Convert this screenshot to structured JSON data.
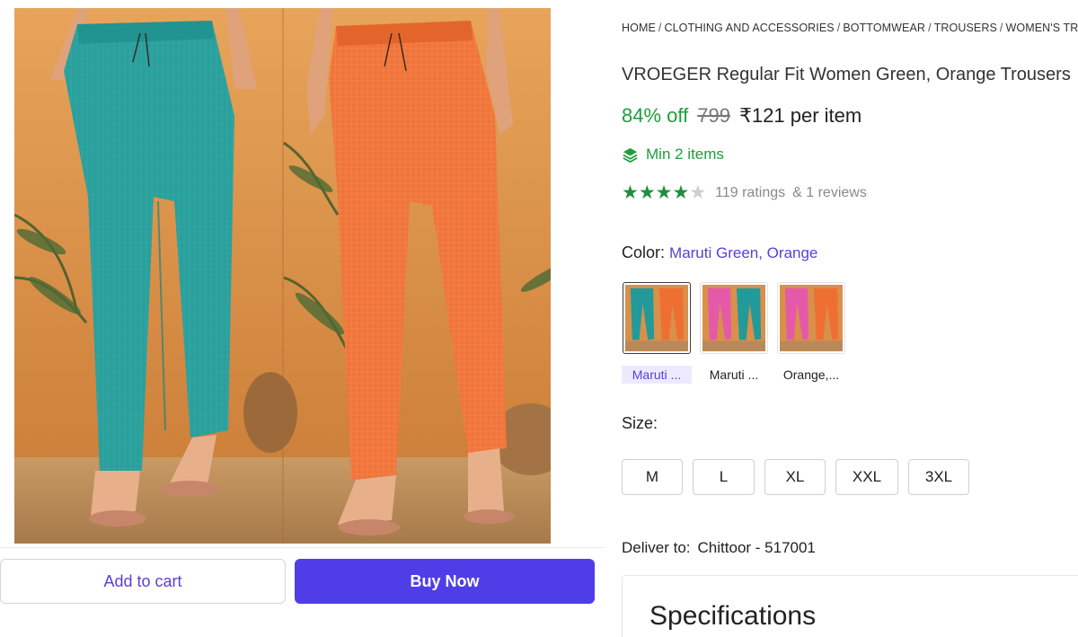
{
  "breadcrumb": [
    "HOME",
    "CLOTHING AND ACCESSORIES",
    "BOTTOMWEAR",
    "TROUSERS",
    "WOMEN'S TROUSERS"
  ],
  "product": {
    "title": "VROEGER Regular Fit Women Green, Orange Trousers",
    "discount": "84% off",
    "mrp": "799",
    "price": "₹121 per item",
    "min_items": "Min 2 items",
    "rating": 4,
    "rating_max": 5,
    "ratings_text": "119 ratings",
    "reviews_text": "& 1 reviews"
  },
  "color": {
    "label": "Color:",
    "value": "Maruti Green, Orange",
    "variants": [
      {
        "label": "Maruti ...",
        "selected": true,
        "left": "#239a9a",
        "right": "#ef6f33"
      },
      {
        "label": "Maruti ...",
        "selected": false,
        "left": "#e55aa8",
        "right": "#239a9a"
      },
      {
        "label": "Orange,...",
        "selected": false,
        "left": "#e55aa8",
        "right": "#ef6f33"
      }
    ]
  },
  "size": {
    "label": "Size:",
    "options": [
      "M",
      "L",
      "XL",
      "XXL",
      "3XL"
    ]
  },
  "delivery": {
    "label": "Deliver to:",
    "location": "Chittoor - 517001"
  },
  "specifications_title": "Specifications",
  "actions": {
    "add_to_cart": "Add to cart",
    "buy_now": "Buy Now"
  },
  "colors": {
    "accent": "#4f3ee8",
    "link": "#5a3fd6",
    "discount_green": "#1e9e3a",
    "teal_trouser": "#239a9a",
    "orange_trouser": "#ef6f33",
    "backdrop": "#e39a4e"
  },
  "icons": {
    "min_items": "stack-layers-icon",
    "star": "star-icon"
  }
}
